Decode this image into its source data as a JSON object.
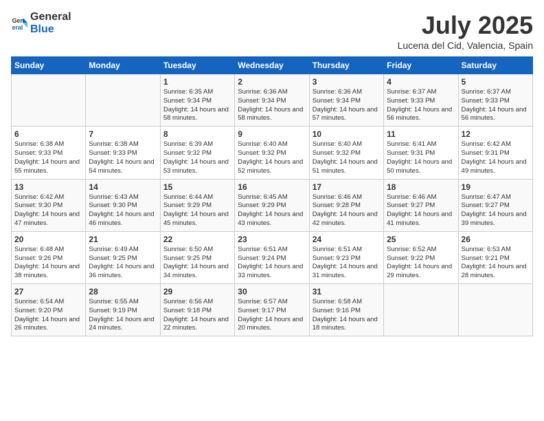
{
  "header": {
    "logo_general": "General",
    "logo_blue": "Blue",
    "month_year": "July 2025",
    "location": "Lucena del Cid, Valencia, Spain"
  },
  "days_of_week": [
    "Sunday",
    "Monday",
    "Tuesday",
    "Wednesday",
    "Thursday",
    "Friday",
    "Saturday"
  ],
  "weeks": [
    [
      {
        "day": "",
        "sunrise": "",
        "sunset": "",
        "daylight": ""
      },
      {
        "day": "",
        "sunrise": "",
        "sunset": "",
        "daylight": ""
      },
      {
        "day": "1",
        "sunrise": "Sunrise: 6:35 AM",
        "sunset": "Sunset: 9:34 PM",
        "daylight": "Daylight: 14 hours and 58 minutes."
      },
      {
        "day": "2",
        "sunrise": "Sunrise: 6:36 AM",
        "sunset": "Sunset: 9:34 PM",
        "daylight": "Daylight: 14 hours and 58 minutes."
      },
      {
        "day": "3",
        "sunrise": "Sunrise: 6:36 AM",
        "sunset": "Sunset: 9:34 PM",
        "daylight": "Daylight: 14 hours and 57 minutes."
      },
      {
        "day": "4",
        "sunrise": "Sunrise: 6:37 AM",
        "sunset": "Sunset: 9:33 PM",
        "daylight": "Daylight: 14 hours and 56 minutes."
      },
      {
        "day": "5",
        "sunrise": "Sunrise: 6:37 AM",
        "sunset": "Sunset: 9:33 PM",
        "daylight": "Daylight: 14 hours and 56 minutes."
      }
    ],
    [
      {
        "day": "6",
        "sunrise": "Sunrise: 6:38 AM",
        "sunset": "Sunset: 9:33 PM",
        "daylight": "Daylight: 14 hours and 55 minutes."
      },
      {
        "day": "7",
        "sunrise": "Sunrise: 6:38 AM",
        "sunset": "Sunset: 9:33 PM",
        "daylight": "Daylight: 14 hours and 54 minutes."
      },
      {
        "day": "8",
        "sunrise": "Sunrise: 6:39 AM",
        "sunset": "Sunset: 9:32 PM",
        "daylight": "Daylight: 14 hours and 53 minutes."
      },
      {
        "day": "9",
        "sunrise": "Sunrise: 6:40 AM",
        "sunset": "Sunset: 9:32 PM",
        "daylight": "Daylight: 14 hours and 52 minutes."
      },
      {
        "day": "10",
        "sunrise": "Sunrise: 6:40 AM",
        "sunset": "Sunset: 9:32 PM",
        "daylight": "Daylight: 14 hours and 51 minutes."
      },
      {
        "day": "11",
        "sunrise": "Sunrise: 6:41 AM",
        "sunset": "Sunset: 9:31 PM",
        "daylight": "Daylight: 14 hours and 50 minutes."
      },
      {
        "day": "12",
        "sunrise": "Sunrise: 6:42 AM",
        "sunset": "Sunset: 9:31 PM",
        "daylight": "Daylight: 14 hours and 49 minutes."
      }
    ],
    [
      {
        "day": "13",
        "sunrise": "Sunrise: 6:42 AM",
        "sunset": "Sunset: 9:30 PM",
        "daylight": "Daylight: 14 hours and 47 minutes."
      },
      {
        "day": "14",
        "sunrise": "Sunrise: 6:43 AM",
        "sunset": "Sunset: 9:30 PM",
        "daylight": "Daylight: 14 hours and 46 minutes."
      },
      {
        "day": "15",
        "sunrise": "Sunrise: 6:44 AM",
        "sunset": "Sunset: 9:29 PM",
        "daylight": "Daylight: 14 hours and 45 minutes."
      },
      {
        "day": "16",
        "sunrise": "Sunrise: 6:45 AM",
        "sunset": "Sunset: 9:29 PM",
        "daylight": "Daylight: 14 hours and 43 minutes."
      },
      {
        "day": "17",
        "sunrise": "Sunrise: 6:46 AM",
        "sunset": "Sunset: 9:28 PM",
        "daylight": "Daylight: 14 hours and 42 minutes."
      },
      {
        "day": "18",
        "sunrise": "Sunrise: 6:46 AM",
        "sunset": "Sunset: 9:27 PM",
        "daylight": "Daylight: 14 hours and 41 minutes."
      },
      {
        "day": "19",
        "sunrise": "Sunrise: 6:47 AM",
        "sunset": "Sunset: 9:27 PM",
        "daylight": "Daylight: 14 hours and 39 minutes."
      }
    ],
    [
      {
        "day": "20",
        "sunrise": "Sunrise: 6:48 AM",
        "sunset": "Sunset: 9:26 PM",
        "daylight": "Daylight: 14 hours and 38 minutes."
      },
      {
        "day": "21",
        "sunrise": "Sunrise: 6:49 AM",
        "sunset": "Sunset: 9:25 PM",
        "daylight": "Daylight: 14 hours and 36 minutes."
      },
      {
        "day": "22",
        "sunrise": "Sunrise: 6:50 AM",
        "sunset": "Sunset: 9:25 PM",
        "daylight": "Daylight: 14 hours and 34 minutes."
      },
      {
        "day": "23",
        "sunrise": "Sunrise: 6:51 AM",
        "sunset": "Sunset: 9:24 PM",
        "daylight": "Daylight: 14 hours and 33 minutes."
      },
      {
        "day": "24",
        "sunrise": "Sunrise: 6:51 AM",
        "sunset": "Sunset: 9:23 PM",
        "daylight": "Daylight: 14 hours and 31 minutes."
      },
      {
        "day": "25",
        "sunrise": "Sunrise: 6:52 AM",
        "sunset": "Sunset: 9:22 PM",
        "daylight": "Daylight: 14 hours and 29 minutes."
      },
      {
        "day": "26",
        "sunrise": "Sunrise: 6:53 AM",
        "sunset": "Sunset: 9:21 PM",
        "daylight": "Daylight: 14 hours and 28 minutes."
      }
    ],
    [
      {
        "day": "27",
        "sunrise": "Sunrise: 6:54 AM",
        "sunset": "Sunset: 9:20 PM",
        "daylight": "Daylight: 14 hours and 26 minutes."
      },
      {
        "day": "28",
        "sunrise": "Sunrise: 6:55 AM",
        "sunset": "Sunset: 9:19 PM",
        "daylight": "Daylight: 14 hours and 24 minutes."
      },
      {
        "day": "29",
        "sunrise": "Sunrise: 6:56 AM",
        "sunset": "Sunset: 9:18 PM",
        "daylight": "Daylight: 14 hours and 22 minutes."
      },
      {
        "day": "30",
        "sunrise": "Sunrise: 6:57 AM",
        "sunset": "Sunset: 9:17 PM",
        "daylight": "Daylight: 14 hours and 20 minutes."
      },
      {
        "day": "31",
        "sunrise": "Sunrise: 6:58 AM",
        "sunset": "Sunset: 9:16 PM",
        "daylight": "Daylight: 14 hours and 18 minutes."
      },
      {
        "day": "",
        "sunrise": "",
        "sunset": "",
        "daylight": ""
      },
      {
        "day": "",
        "sunrise": "",
        "sunset": "",
        "daylight": ""
      }
    ]
  ]
}
